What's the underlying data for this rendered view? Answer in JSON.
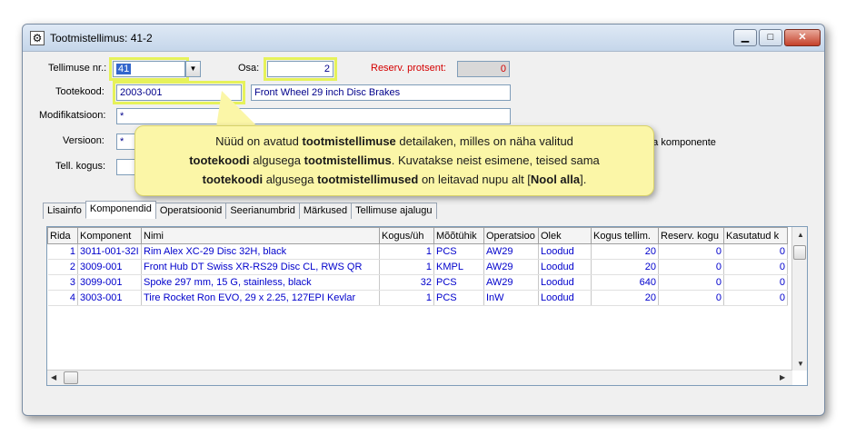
{
  "window": {
    "title": "Tootmistellimus: 41-2"
  },
  "form": {
    "order_no_label": "Tellimuse nr.:",
    "order_no_value": "41",
    "part_label": "Osa:",
    "part_value": "2",
    "reserve_label": "Reserv. protsent:",
    "reserve_value": "0",
    "product_code_label": "Tootekood:",
    "product_code_value": "2003-001",
    "product_name_value": "Front Wheel 29 inch Disc Brakes",
    "modification_label": "Modifikatsioon:",
    "modification_value": "*",
    "version_label": "Versioon:",
    "version_value": "*",
    "quantity_label": "Tell. kogus:",
    "side_text": "ata komponente"
  },
  "callout": {
    "line1_a": "Nüüd on avatud ",
    "line1_b": "tootmistellimuse",
    "line1_c": " detailaken, milles on näha valitud",
    "line2_a": "tootekoodi",
    "line2_b": " algusega ",
    "line2_c": "tootmistellimus",
    "line2_d": ". Kuvatakse neist esimene, teised sama",
    "line3_a": "tootekoodi",
    "line3_b": " algusega ",
    "line3_c": "tootmistellimused",
    "line3_d": " on leitavad nupu alt [",
    "line3_e": "Nool alla",
    "line3_f": "]."
  },
  "tabs": [
    "Lisainfo",
    "Komponendid",
    "Operatsioonid",
    "Seerianumbrid",
    "Märkused",
    "Tellimuse ajalugu"
  ],
  "grid": {
    "columns": [
      "Rida",
      "Komponent",
      "Nimi",
      "Kogus/üh",
      "Mõõtühik",
      "Operatsioo",
      "Olek",
      "Kogus tellim.",
      "Reserv. kogu",
      "Kasutatud k"
    ],
    "rows": [
      [
        "1",
        "3011-001-32I",
        "Rim Alex XC-29 Disc 32H, black",
        "1",
        "PCS",
        "AW29",
        "Loodud",
        "20",
        "0",
        "0"
      ],
      [
        "2",
        "3009-001",
        "Front Hub DT Swiss XR-RS29 Disc CL, RWS QR",
        "1",
        "KMPL",
        "AW29",
        "Loodud",
        "20",
        "0",
        "0"
      ],
      [
        "3",
        "3099-001",
        "Spoke 297 mm, 15 G, stainless, black",
        "32",
        "PCS",
        "AW29",
        "Loodud",
        "640",
        "0",
        "0"
      ],
      [
        "4",
        "3003-001",
        "Tire Rocket Ron EVO, 29 x 2.25, 127EPI Kevlar",
        "1",
        "PCS",
        "InW",
        "Loodud",
        "20",
        "0",
        "0"
      ]
    ]
  }
}
